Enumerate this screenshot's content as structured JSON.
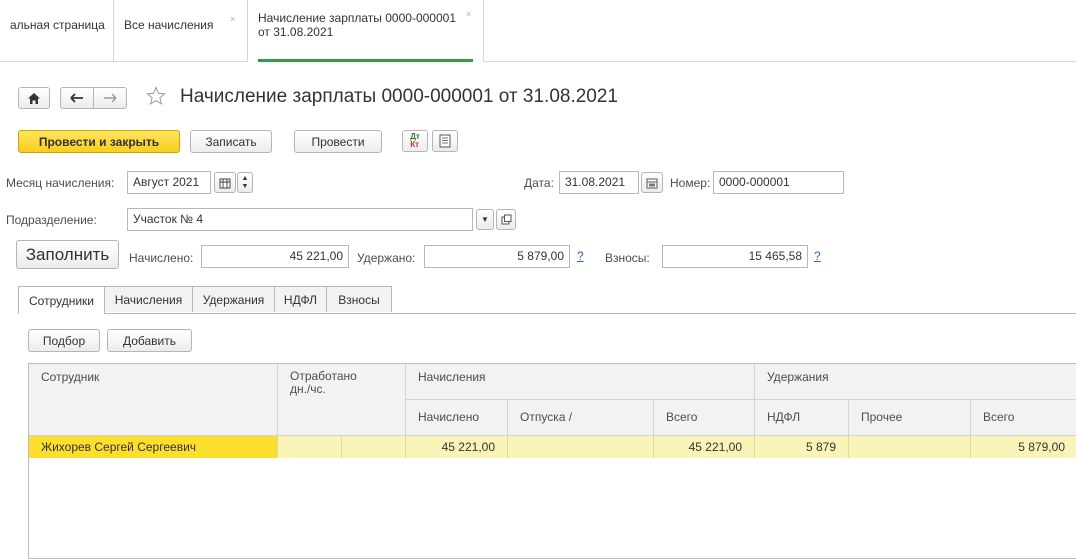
{
  "tabs": [
    {
      "label": "альная страница"
    },
    {
      "label": "Все начисления",
      "close": "×"
    },
    {
      "label_line1": "Начисление зарплаты 0000-000001",
      "label_line2": "от 31.08.2021",
      "close": "×"
    }
  ],
  "page": {
    "title": "Начисление зарплаты 0000-000001 от 31.08.2021"
  },
  "toolbar": {
    "post_close": "Провести и закрыть",
    "save": "Записать",
    "post": "Провести",
    "dtkt_icon_text_top": "Дт",
    "dtkt_icon_text_bottom": "Кт"
  },
  "header": {
    "month_label": "Месяц начисления:",
    "month_value": "Август 2021",
    "date_label": "Дата:",
    "date_value": "31.08.2021",
    "number_label": "Номер:",
    "number_value": "0000-000001",
    "division_label": "Подразделение:",
    "division_value": "Участок № 4"
  },
  "totals": {
    "fill_button": "Заполнить",
    "accrued_label": "Начислено:",
    "accrued_value": "45 221,00",
    "withheld_label": "Удержано:",
    "withheld_value": "5 879,00",
    "contributions_label": "Взносы:",
    "contributions_value": "15 465,58",
    "help": "?"
  },
  "inner_tabs": [
    "Сотрудники",
    "Начисления",
    "Удержания",
    "НДФЛ",
    "Взносы"
  ],
  "table_toolbar": {
    "pick": "Подбор",
    "add": "Добавить"
  },
  "table": {
    "headers": {
      "employee": "Сотрудник",
      "worked_line1": "Отработано",
      "worked_line2": "дн./чс.",
      "accruals_group": "Начисления",
      "accrued": "Начислено",
      "vacations": "Отпуска /",
      "accruals_total": "Всего",
      "deductions_group": "Удержания",
      "ndfl": "НДФЛ",
      "other": "Прочее",
      "deductions_total": "Всего"
    },
    "rows": [
      {
        "employee": "Жихорев Сергей Сергеевич",
        "accrued": "45 221,00",
        "vacations": "",
        "accruals_total": "45 221,00",
        "ndfl": "5 879",
        "other": "",
        "deductions_total": "5 879,00"
      }
    ]
  },
  "colors": {
    "primary_button": "#f8cf1e",
    "active_tab_underline": "#2f9e44",
    "selected_row": "#fcde2d",
    "row": "#fbf4b8",
    "link": "#2a62c9"
  }
}
